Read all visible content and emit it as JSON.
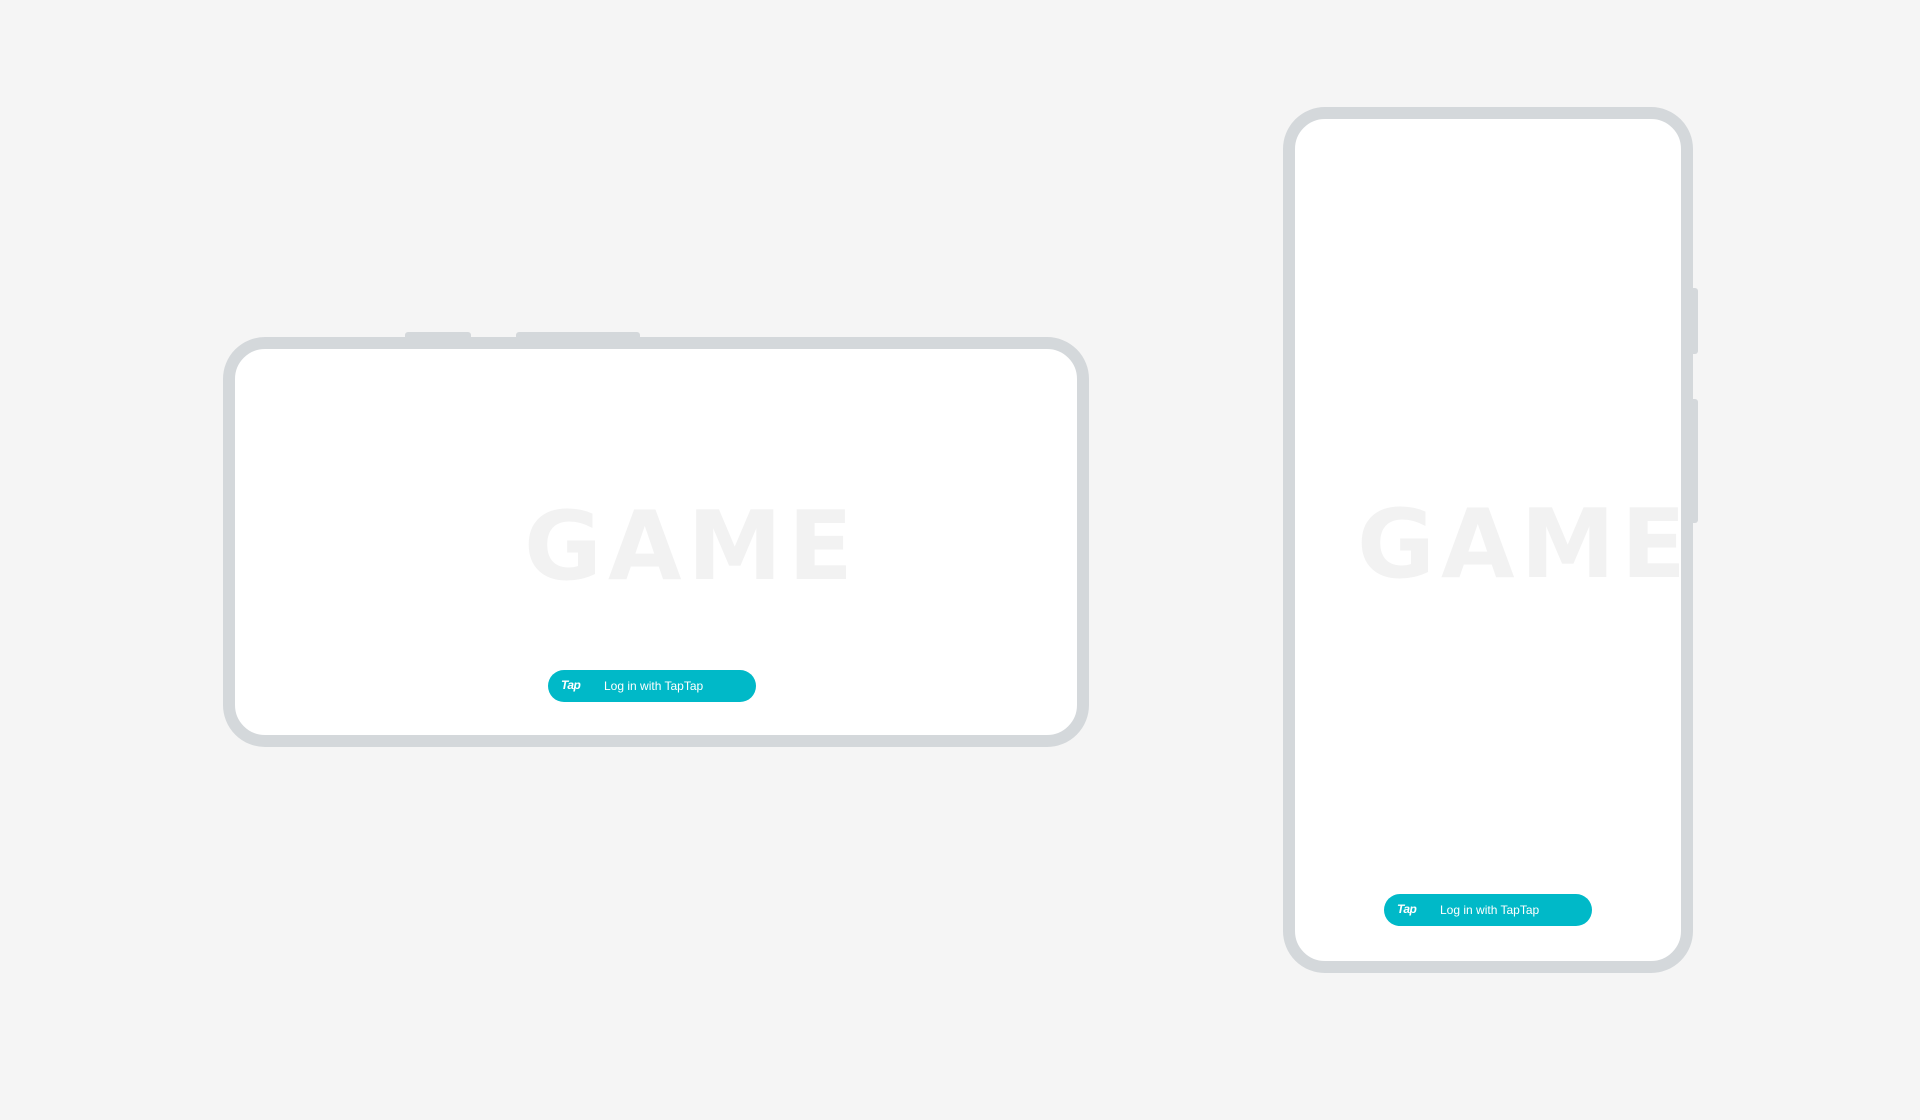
{
  "landscape": {
    "game_title": "GAME",
    "login_button": {
      "logo_text": "Tap",
      "label": "Log in with TapTap"
    }
  },
  "portrait": {
    "game_title": "GAME",
    "login_button": {
      "logo_text": "Tap",
      "label": "Log in with TapTap"
    }
  },
  "colors": {
    "background": "#f5f5f5",
    "device_frame": "#d4d8db",
    "screen": "#ffffff",
    "game_title": "#f2f2f2",
    "taptap_accent": "#00b9c8"
  }
}
